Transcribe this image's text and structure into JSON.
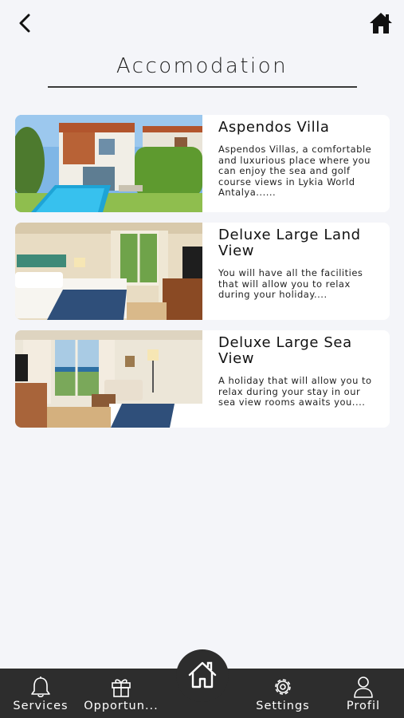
{
  "header": {
    "back_icon": "chevron-left-icon",
    "home_icon": "home-icon",
    "title": "Accomodation"
  },
  "rooms": [
    {
      "title": "Aspendos Villa",
      "description": "Aspendos Villas, a comfortable and luxurious place where you can enjoy the sea and golf course views in Lykia World Antalya......",
      "image": "villa-pool-photo"
    },
    {
      "title": "Deluxe Large Land View",
      "description": "You will have all the facilities that will allow you to relax during your holiday....",
      "image": "land-view-room-photo"
    },
    {
      "title": "Deluxe Large Sea View",
      "description": "A holiday that will allow you to relax during your stay in our sea view rooms awaits you....",
      "image": "sea-view-room-photo"
    }
  ],
  "tabbar": {
    "services": "Services",
    "opportunities": "Opportun...",
    "settings": "Settings",
    "profile": "Profil",
    "center_icon": "home-icon"
  },
  "colors": {
    "background": "#f4f5f9",
    "tabbar": "#2d2d2d"
  }
}
